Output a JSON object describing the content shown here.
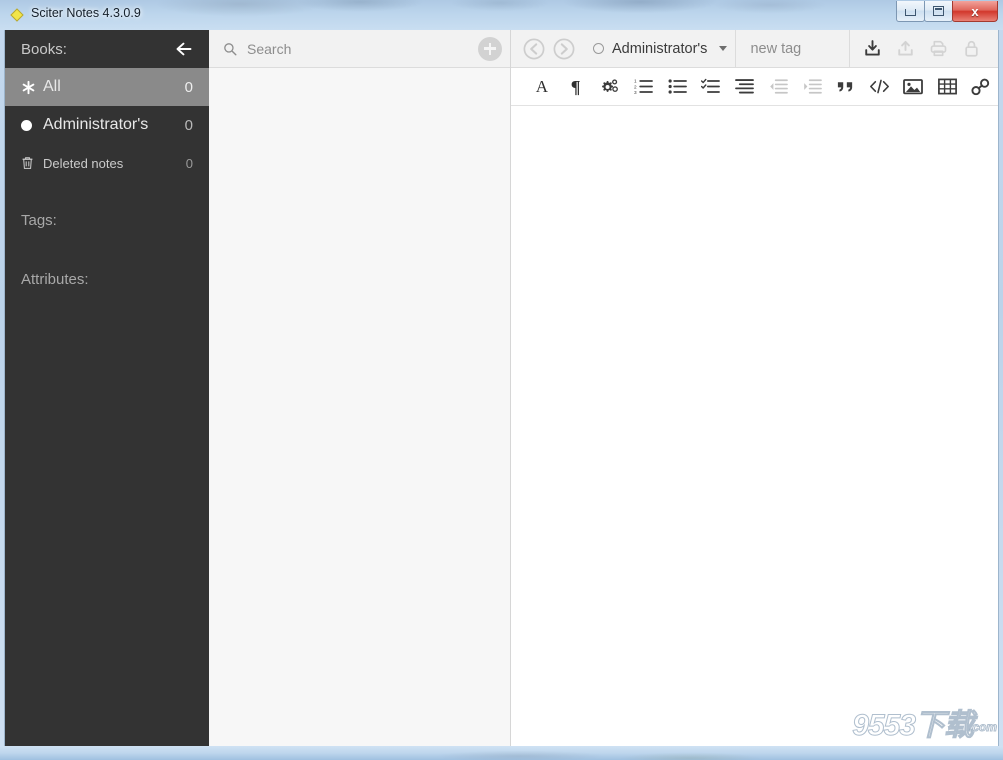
{
  "window": {
    "title": "Sciter Notes 4.3.0.9",
    "app_icon": "yellow-diamond-icon",
    "controls": {
      "minimize": "minimize-button",
      "maximize": "maximize-button",
      "close_label": "x"
    }
  },
  "sidebar": {
    "books_label": "Books:",
    "collapse_icon": "arrow-left-icon",
    "books": [
      {
        "icon": "asterisk-icon",
        "label": "All",
        "count": "0",
        "selected": true
      },
      {
        "icon": "circle-filled-icon",
        "label": "Administrator's",
        "count": "0",
        "selected": false
      },
      {
        "icon": "trash-icon",
        "label": "Deleted notes",
        "count": "0",
        "selected": false,
        "small": true
      }
    ],
    "tags_label": "Tags:",
    "attributes_label": "Attributes:"
  },
  "list_pane": {
    "search": {
      "icon": "search-icon",
      "value": "",
      "placeholder": "Search"
    },
    "add_note_icon": "plus-circle-icon",
    "notes": []
  },
  "editor": {
    "nav": {
      "back_icon": "arrow-left-circle-icon",
      "forward_icon": "arrow-right-circle-icon",
      "book_selector": {
        "marker_icon": "circle-outline-icon",
        "label": "Administrator's",
        "caret_icon": "chevron-down-icon"
      },
      "tag_input": {
        "value": "",
        "placeholder": "new tag"
      },
      "actions": [
        {
          "name": "import-icon",
          "label": "import",
          "enabled": true
        },
        {
          "name": "export-icon",
          "label": "export",
          "enabled": false
        },
        {
          "name": "print-icon",
          "label": "print",
          "enabled": false
        },
        {
          "name": "lock-icon",
          "label": "lock",
          "enabled": false
        }
      ]
    },
    "toolbar": [
      {
        "name": "font-style-icon",
        "label": "A",
        "enabled": true
      },
      {
        "name": "paragraph-icon",
        "label": "¶",
        "enabled": true
      },
      {
        "name": "settings-gears-icon",
        "label": "",
        "enabled": true
      },
      {
        "name": "ordered-list-icon",
        "label": "",
        "enabled": true
      },
      {
        "name": "unordered-list-icon",
        "label": "",
        "enabled": true
      },
      {
        "name": "checklist-icon",
        "label": "",
        "enabled": true
      },
      {
        "name": "definition-list-icon",
        "label": "",
        "enabled": true
      },
      {
        "name": "outdent-icon",
        "label": "",
        "enabled": false
      },
      {
        "name": "indent-icon",
        "label": "",
        "enabled": false
      },
      {
        "name": "blockquote-icon",
        "label": "",
        "enabled": true
      },
      {
        "name": "code-icon",
        "label": "",
        "enabled": true
      },
      {
        "name": "image-icon",
        "label": "",
        "enabled": true
      },
      {
        "name": "table-icon",
        "label": "",
        "enabled": true
      },
      {
        "name": "link-icon",
        "label": "",
        "enabled": true
      }
    ],
    "content": ""
  },
  "watermark": {
    "text": "9553",
    "suffix": "下载",
    "domain": ".com"
  },
  "colors": {
    "sidebar_bg": "#333333",
    "sidebar_selected": "#8a8a8a",
    "list_bg": "#f7f7f7",
    "editor_bg": "#ffffff",
    "frame": "#bcd5ec",
    "close_button": "#d2372b"
  }
}
